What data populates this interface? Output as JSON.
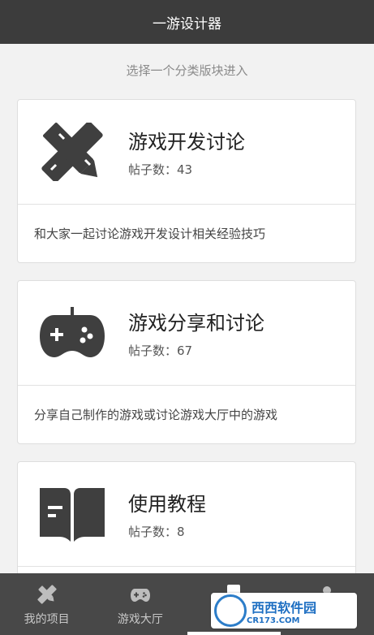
{
  "header": {
    "title": "一游设计器"
  },
  "intro": "选择一个分类版块进入",
  "categories": [
    {
      "title": "游戏开发讨论",
      "count": "帖子数：43",
      "desc": "和大家一起讨论游戏开发设计相关经验技巧",
      "icon": "pencil-ruler-icon"
    },
    {
      "title": "游戏分享和讨论",
      "count": "帖子数：67",
      "desc": "分享自己制作的游戏或讨论游戏大厅中的游戏",
      "icon": "gamepad-icon"
    },
    {
      "title": "使用教程",
      "count": "帖子数：8",
      "desc": "",
      "icon": "book-icon"
    }
  ],
  "nav": {
    "items": [
      {
        "label": "我的项目",
        "icon": "pencil-ruler-icon"
      },
      {
        "label": "游戏大厅",
        "icon": "gamepad-icon"
      },
      {
        "label": "",
        "icon": "document-icon"
      },
      {
        "label": "",
        "icon": "person-icon"
      }
    ],
    "active_index": 2
  },
  "watermark": {
    "text": "西西软件园",
    "sub": "CR173.COM"
  },
  "colors": {
    "header_bg": "#3c3c3c",
    "nav_bg": "#484848",
    "icon": "#3f3f3f",
    "page_bg": "#f2f2f2"
  }
}
